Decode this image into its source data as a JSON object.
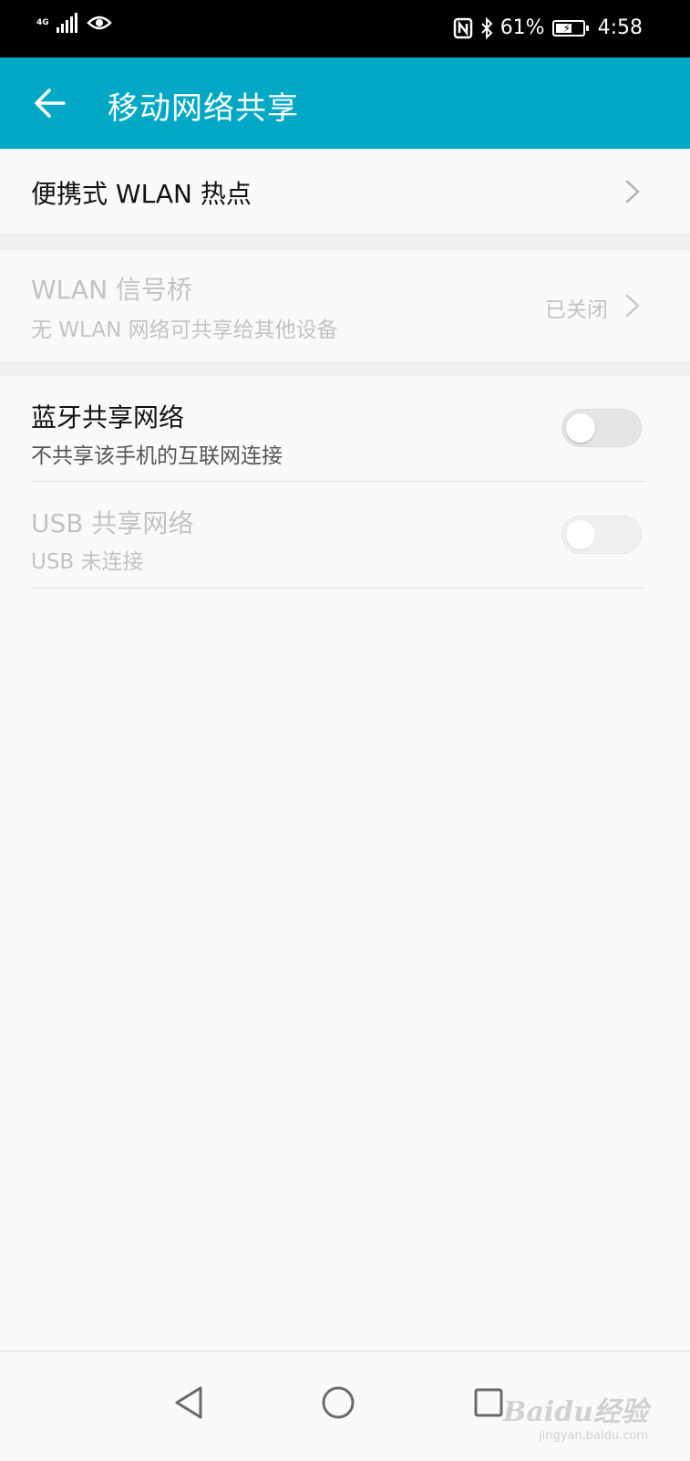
{
  "status_bar": {
    "network_type": "4G",
    "bluetooth_icon": "bluetooth-icon",
    "nfc_icon": "nfc-icon",
    "eye_icon": "eye-comfort-icon",
    "battery_percent_text": "61%",
    "battery_level": 0.61,
    "time": "4:58"
  },
  "app_bar": {
    "title": "移动网络共享",
    "back_icon": "arrow-left-icon",
    "color": "#00a8c6"
  },
  "settings": {
    "hotspot": {
      "title": "便携式 WLAN 热点"
    },
    "bridge": {
      "title": "WLAN 信号桥",
      "subtitle": "无 WLAN 网络可共享给其他设备",
      "status": "已关闭",
      "enabled": false
    },
    "bluetooth_tether": {
      "title": "蓝牙共享网络",
      "subtitle": "不共享该手机的互联网连接",
      "checked": false
    },
    "usb_tether": {
      "title": "USB 共享网络",
      "subtitle": "USB 未连接",
      "checked": false,
      "enabled": false
    }
  },
  "nav_bar": {
    "back_icon": "triangle-back-icon",
    "home_icon": "circle-home-icon",
    "recents_icon": "square-recents-icon"
  },
  "watermark": {
    "main": "Baidu经验",
    "sub": "jingyan.baidu.com"
  }
}
